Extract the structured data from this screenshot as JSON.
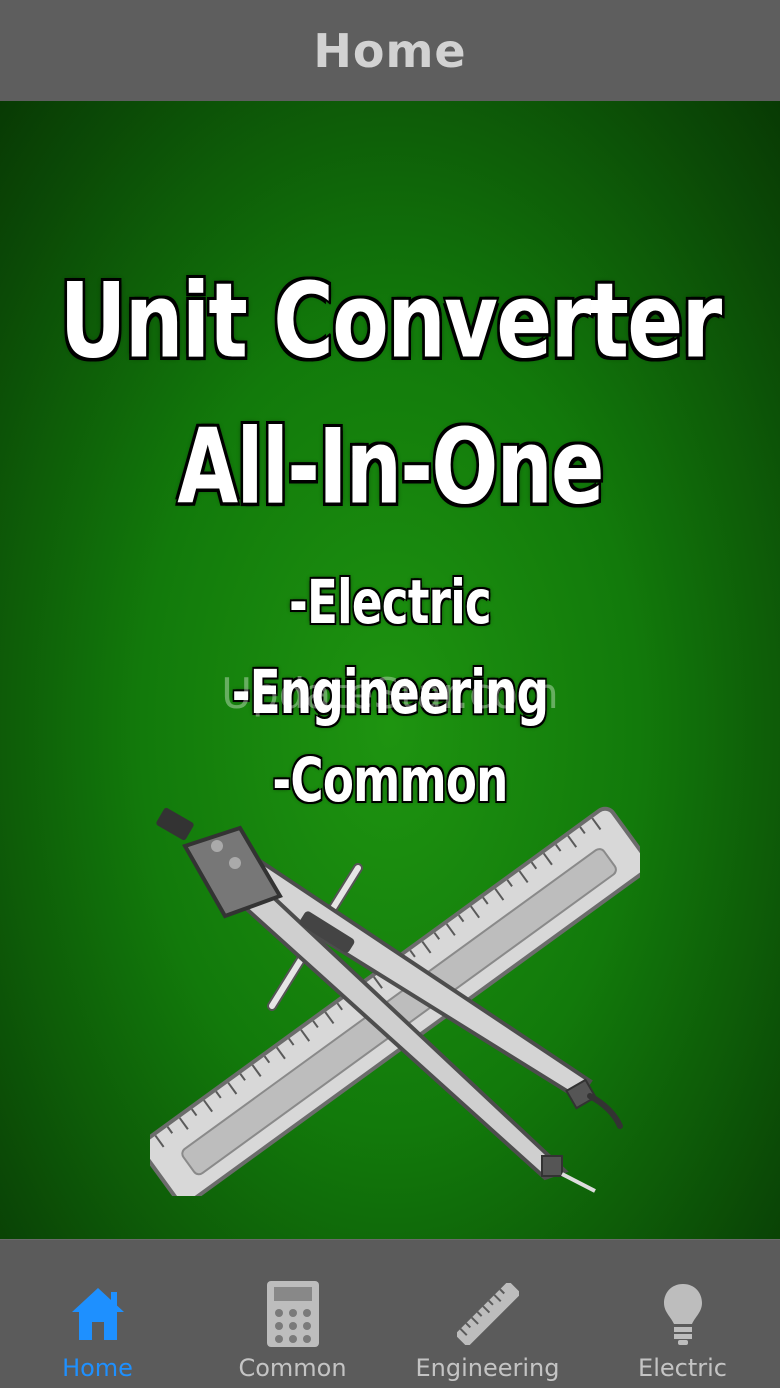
{
  "navbar": {
    "title": "Home"
  },
  "hero": {
    "title_line1": "Unit Converter",
    "title_line2": "All-In-One",
    "items": [
      "-Electric",
      "-Engineering",
      "-Common"
    ],
    "watermark": "UpdateStar.com",
    "illustration": "compass-and-ruler-icon"
  },
  "tabbar": {
    "active_color": "#1e90ff",
    "inactive_color": "#c4c4c4",
    "tabs": [
      {
        "label": "Home",
        "icon": "home-icon",
        "active": true
      },
      {
        "label": "Common",
        "icon": "calculator-icon",
        "active": false
      },
      {
        "label": "Engineering",
        "icon": "ruler-icon",
        "active": false
      },
      {
        "label": "Electric",
        "icon": "lightbulb-icon",
        "active": false
      }
    ]
  }
}
